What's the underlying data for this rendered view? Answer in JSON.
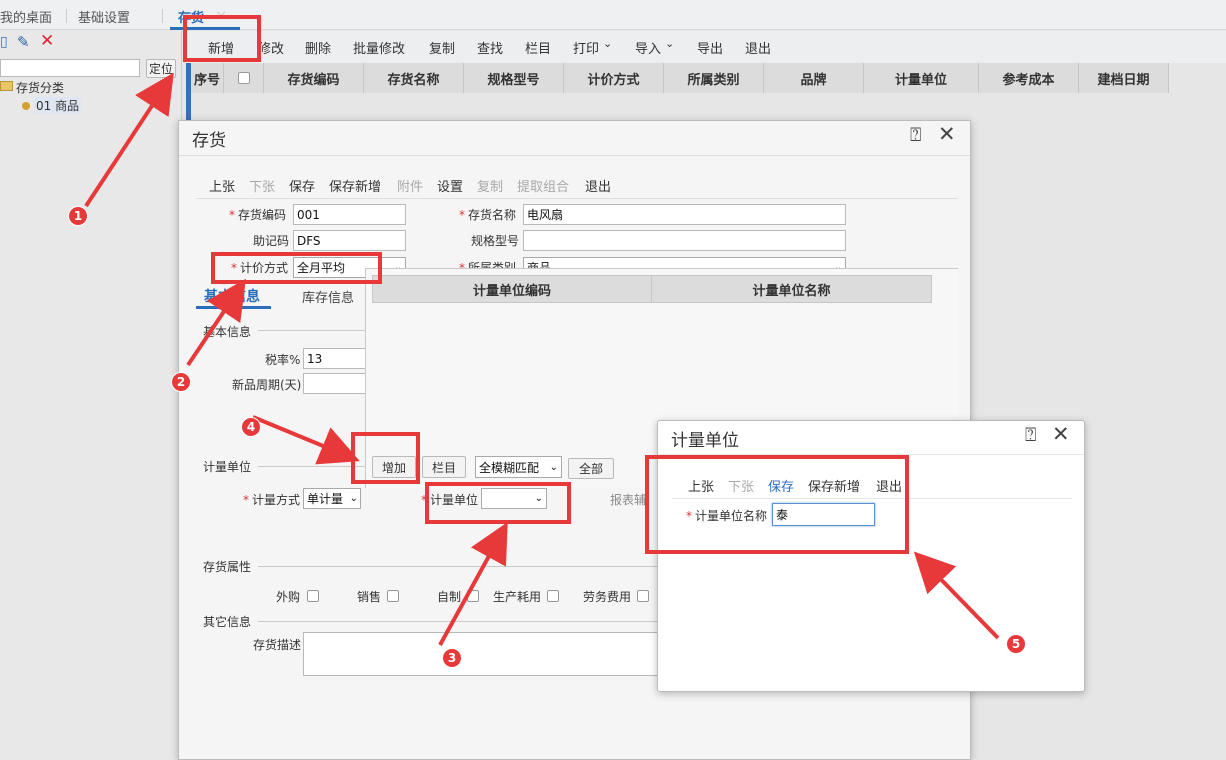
{
  "top_tabs": [
    "我的桌面",
    "基础设置",
    "存货"
  ],
  "left": {
    "locate_label": "定位",
    "tree_root": "存货分类",
    "tree_child": "01 商品"
  },
  "main_toolbar": [
    "新增",
    "修改",
    "删除",
    "批量修改",
    "复制",
    "查找",
    "栏目",
    "打印",
    "导入",
    "导出",
    "退出"
  ],
  "grid_headers": [
    "序号",
    "存货编码",
    "存货名称",
    "规格型号",
    "计价方式",
    "所属类别",
    "品牌",
    "计量单位",
    "参考成本",
    "建档日期"
  ],
  "inventory_dialog": {
    "title": "存货",
    "toolbar": [
      "上张",
      "下张",
      "保存",
      "保存新增",
      "附件",
      "设置",
      "复制",
      "提取组合",
      "退出"
    ],
    "fields": {
      "code_label": "存货编码",
      "code_value": "001",
      "name_label": "存货名称",
      "name_value": "电风扇",
      "mnemonic_label": "助记码",
      "mnemonic_value": "DFS",
      "spec_label": "规格型号",
      "spec_value": "",
      "pricing_label": "计价方式",
      "pricing_value": "全月平均",
      "category_label": "所属类别",
      "category_value": "商品"
    },
    "tabs": [
      "基本信息",
      "库存信息"
    ],
    "basic_section": "基本信息",
    "tax_label": "税率%",
    "tax_value": "13",
    "cycle_label": "新品周期(天)",
    "unit_section": "计量单位",
    "measure_method_label": "计量方式",
    "measure_method_value": "单计量",
    "unit_label": "计量单位",
    "report_aux_label": "报表辅",
    "attr_section": "存货属性",
    "attrs": [
      "外购",
      "销售",
      "自制",
      "生产耗用",
      "劳务费用"
    ],
    "other_section": "其它信息",
    "desc_label": "存货描述"
  },
  "unit_lookup": {
    "headers": [
      "计量单位编码",
      "计量单位名称"
    ],
    "add_label": "增加",
    "column_label": "栏目",
    "match_value": "全模糊匹配",
    "all_label": "全部"
  },
  "unit_dialog": {
    "title": "计量单位",
    "toolbar": [
      "上张",
      "下张",
      "保存",
      "保存新增",
      "退出"
    ],
    "name_label": "计量单位名称",
    "name_value": "泰"
  },
  "badges": [
    "1",
    "2",
    "3",
    "4",
    "5"
  ],
  "colors": {
    "accent": "#2a6ebb",
    "annotation": "#e8393a"
  }
}
